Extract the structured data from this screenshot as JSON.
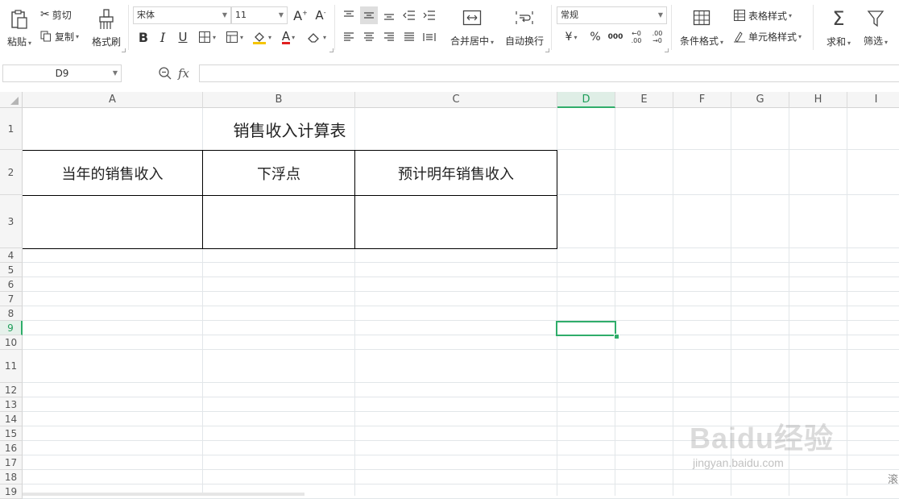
{
  "ribbon": {
    "paste": "粘贴",
    "cut": "剪切",
    "copy": "复制",
    "format_painter": "格式刷",
    "font_name": "宋体",
    "font_size": "11",
    "bold": "B",
    "italic": "I",
    "underline": "U",
    "font_color_letter": "A",
    "merge_center": "合并居中",
    "auto_wrap": "自动换行",
    "number_format": "常规",
    "currency": "¥",
    "percent": "%",
    "thousands": "000",
    "dec_increase": ".00",
    "dec_decrease": ".00",
    "cond_format": "条件格式",
    "table_style": "表格样式",
    "cell_style": "单元格样式",
    "sum": "求和",
    "filter": "筛选"
  },
  "formula_bar": {
    "cell_ref": "D9",
    "fx": "fx",
    "value": ""
  },
  "sheet": {
    "columns": [
      "A",
      "B",
      "C",
      "D",
      "E",
      "F",
      "G",
      "H",
      "I"
    ],
    "rows": [
      "1",
      "2",
      "3",
      "4",
      "5",
      "6",
      "7",
      "8",
      "9",
      "10",
      "11",
      "12",
      "13",
      "14",
      "15",
      "16",
      "17",
      "18",
      "19"
    ],
    "active_cell": "D9",
    "title": "销售收入计算表",
    "headers": [
      "当年的销售收入",
      "下浮点",
      "预计明年销售收入"
    ]
  },
  "colors": {
    "accent": "#2fad6a",
    "grid": "#e2e6e9",
    "header_bg": "#f5f5f5"
  },
  "watermark": {
    "brand": "Baidu经验",
    "url": "jingyan.baidu.com"
  },
  "edge_text": "滚"
}
